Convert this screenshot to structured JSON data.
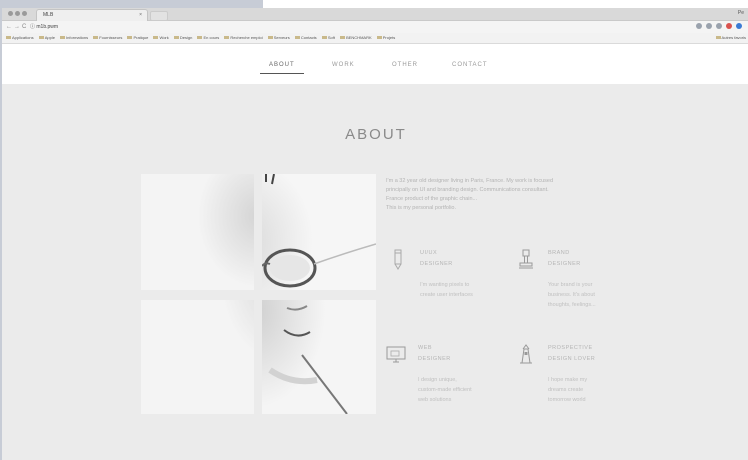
{
  "browser": {
    "tab_title": "MLB",
    "tab_close": "×",
    "user_name": "Pe",
    "address": "ⓘ m1b.pwm",
    "nav_back": "←",
    "nav_forward": "→",
    "nav_reload": "C",
    "bookmarks": [
      "Applications",
      "Apple",
      "Informations",
      "Fournisseurs",
      "Pratique",
      "Work",
      "Design",
      "En cours",
      "Recherche emploi",
      "Serveurs",
      "Contacts",
      "Soft",
      "BENCHMARK",
      "Projets"
    ],
    "bookmarks_right": "Autres favoris"
  },
  "nav": {
    "items": [
      {
        "label": "ABOUT"
      },
      {
        "label": "WORK"
      },
      {
        "label": "OTHER"
      },
      {
        "label": "CONTACT"
      }
    ]
  },
  "page": {
    "title": "ABOUT",
    "intro": [
      "I'm a 32 year old designer living in Paris, France. My work is focused",
      "principally on UI and branding design. Communications consultant.",
      "France product of the graphic chain...",
      "This is my personal portfolio."
    ]
  },
  "services": [
    {
      "icon": "pencil-icon",
      "title_line1": "UI/UX",
      "title_line2": "DESIGNER",
      "desc": [
        "I'm wanting pixels to",
        "create user interfaces"
      ]
    },
    {
      "icon": "stamp-icon",
      "title_line1": "BRAND",
      "title_line2": "DESIGNER",
      "desc": [
        "Your brand is your",
        "business. It's about",
        "thoughts, feelings..."
      ]
    },
    {
      "icon": "monitor-icon",
      "title_line1": "WEB",
      "title_line2": "DESIGNER",
      "desc": [
        "I design unique,",
        "custom-made efficient",
        "web solutions"
      ]
    },
    {
      "icon": "lighthouse-icon",
      "title_line1": "PROSPECTIVE",
      "title_line2": "DESIGN LOVER",
      "desc": [
        "I hope make my",
        "dreams create",
        "tomorrow world"
      ]
    }
  ],
  "colors": {
    "background": "#ebebeb",
    "header": "#ffffff",
    "text_muted": "#b3b3b3"
  }
}
